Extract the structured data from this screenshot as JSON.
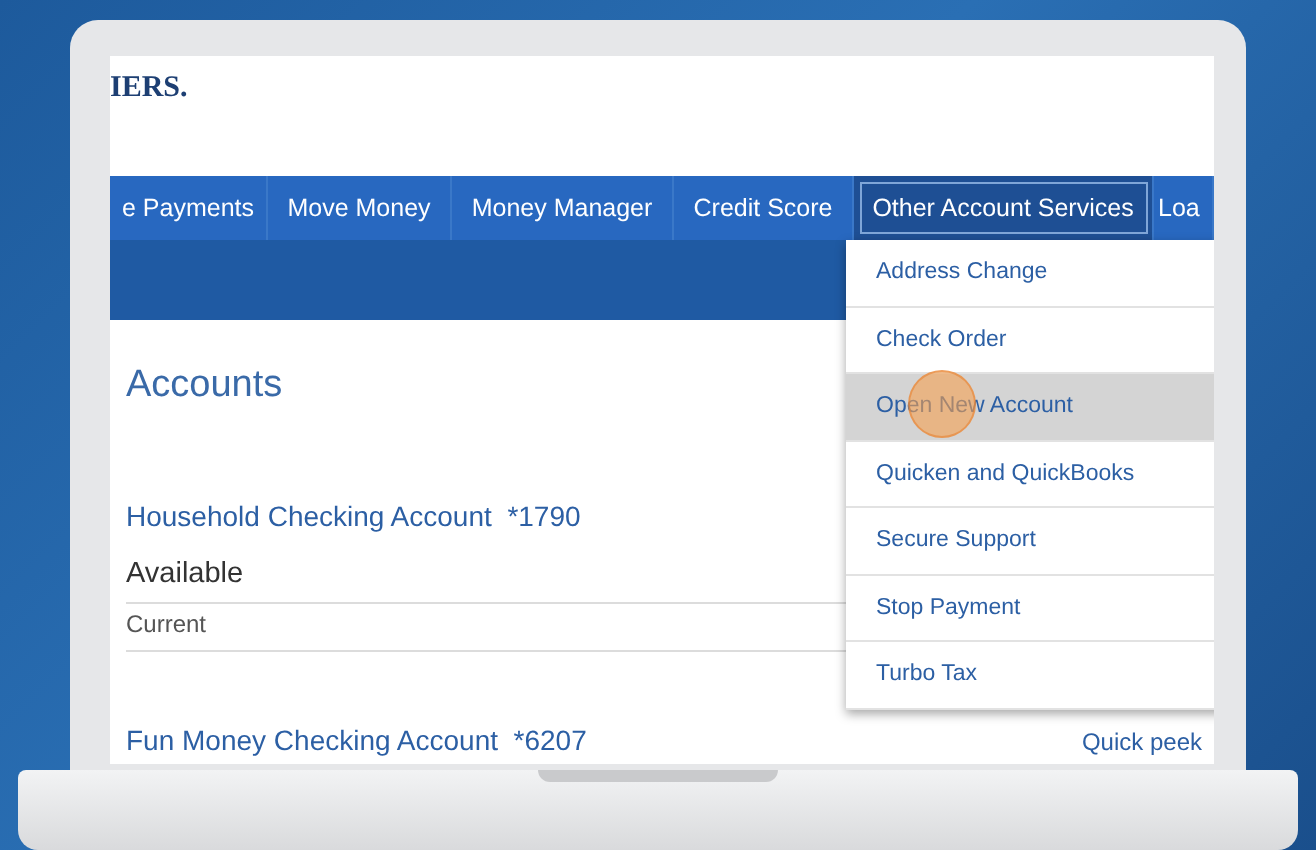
{
  "header": {
    "logo": "IERS."
  },
  "nav": [
    {
      "label": "e Payments",
      "selected": false
    },
    {
      "label": "Move Money",
      "selected": false
    },
    {
      "label": "Money Manager",
      "selected": false
    },
    {
      "label": "Credit Score",
      "selected": false
    },
    {
      "label": "Other Account Services",
      "selected": true
    },
    {
      "label": "Loa",
      "selected": false
    }
  ],
  "dropdown": [
    {
      "label": "Address Change",
      "selected": false
    },
    {
      "label": "Check Order",
      "selected": false
    },
    {
      "label": "Open New Account",
      "selected": true
    },
    {
      "label": "Quicken and QuickBooks",
      "selected": false
    },
    {
      "label": "Secure Support",
      "selected": false
    },
    {
      "label": "Stop Payment",
      "selected": false
    },
    {
      "label": "Turbo Tax",
      "selected": false
    }
  ],
  "page_title": "Accounts",
  "accounts": [
    {
      "name": "Household Checking Account",
      "number": "*1790",
      "balances": [
        "Available",
        "Current"
      ]
    },
    {
      "name": "Fun Money Checking Account",
      "number": "*6207",
      "link": "Quick peek"
    }
  ]
}
